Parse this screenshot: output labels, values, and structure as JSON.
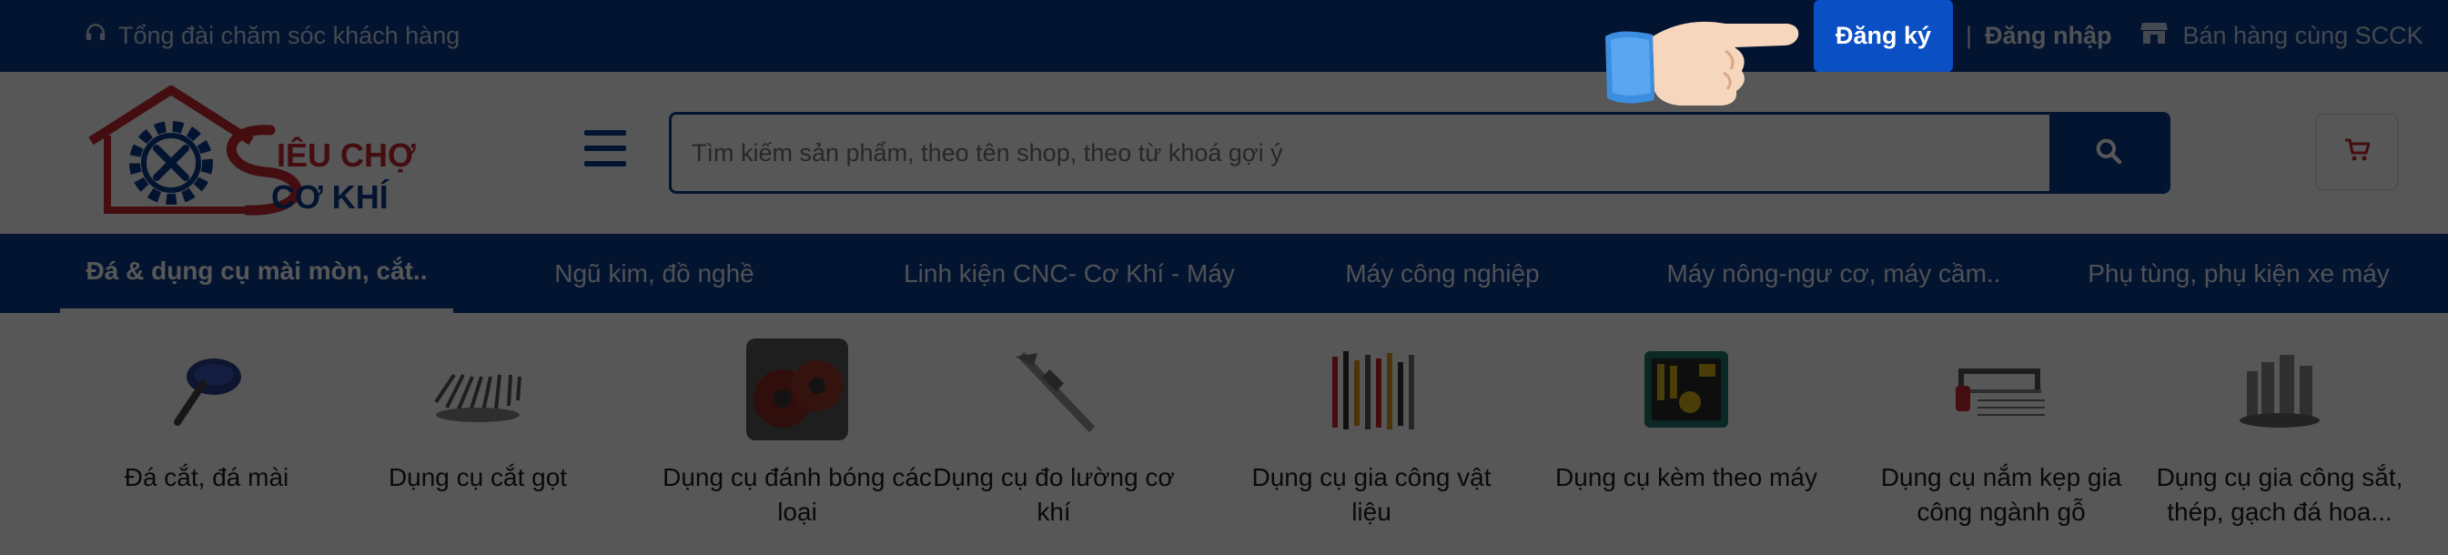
{
  "topbar": {
    "hotline_label": "Tổng đài chăm sóc khách hàng",
    "register_label": "Đăng ký",
    "separator": "|",
    "login_label": "Đăng nhập",
    "sell_label": "Bán hàng cùng SCCK"
  },
  "header": {
    "logo_line1": "IÊU CHỢ",
    "logo_line2": "CƠ KHÍ",
    "search_placeholder": "Tìm kiếm sản phẩm, theo tên shop, theo từ khoá gợi ý"
  },
  "categories": [
    {
      "label": "Đá & dụng cụ mài mòn, cắt..",
      "active": true
    },
    {
      "label": "Ngũ kim, đồ nghề",
      "active": false
    },
    {
      "label": "Linh kiện CNC- Cơ Khí - Máy",
      "active": false
    },
    {
      "label": "Máy công nghiệp",
      "active": false
    },
    {
      "label": "Máy nông-ngư cơ, máy cầm..",
      "active": false
    },
    {
      "label": "Phụ tùng, phụ kiện xe máy",
      "active": false
    }
  ],
  "subcategories": [
    {
      "label": "Đá cắt, đá mài",
      "icon": "grinding-wheel-icon"
    },
    {
      "label": "Dụng cụ cắt gọt",
      "icon": "cutting-tools-icon"
    },
    {
      "label": "Dụng cụ đánh bóng các loại",
      "icon": "polishing-discs-icon"
    },
    {
      "label": "Dụng cụ đo lường cơ khí",
      "icon": "caliper-icon"
    },
    {
      "label": "Dụng cụ gia công vật liệu",
      "icon": "hand-tools-icon"
    },
    {
      "label": "Dụng cụ kèm theo máy",
      "icon": "tool-kit-icon"
    },
    {
      "label": "Dụng cụ nắm kẹp gia công ngành gỗ",
      "icon": "hacksaw-icon"
    },
    {
      "label": "Dụng cụ gia công sắt, thép, gạch đá hoa...",
      "icon": "drill-bits-icon"
    }
  ],
  "colors": {
    "brand_navy": "#0a3d91",
    "highlight_blue": "#0b4fc4",
    "logo_red": "#c8262f",
    "overlay": "rgba(0,0,0,0.66)"
  }
}
